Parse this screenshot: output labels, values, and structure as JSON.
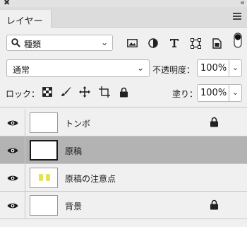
{
  "panel": {
    "close_glyph": "✖",
    "collapse_glyph": "‹‹",
    "tab_label": "レイヤー",
    "menu_icon": "hamburger-icon"
  },
  "filter": {
    "kind_label": "種類",
    "icons": [
      "image-filter-icon",
      "adjustment-filter-icon",
      "text-filter-icon",
      "shape-filter-icon",
      "smart-object-filter-icon",
      "filter-toggle-icon"
    ]
  },
  "blend": {
    "mode": "通常",
    "opacity_label": "不透明度：",
    "opacity_value": "100%"
  },
  "lock": {
    "label": "ロック：",
    "icons": [
      "lock-transparent-pixels-icon",
      "lock-image-pixels-icon",
      "lock-position-icon",
      "lock-artboard-icon",
      "lock-all-icon"
    ],
    "fill_label": "塗り：",
    "fill_value": "100%"
  },
  "layers": [
    {
      "name": "トンボ",
      "thumbnail": "transparent",
      "visible": true,
      "locked": true,
      "selected": false
    },
    {
      "name": "原稿",
      "thumbnail": "transparent",
      "visible": true,
      "locked": false,
      "selected": true
    },
    {
      "name": "原稿の注意点",
      "thumbnail": "yellow-marks",
      "visible": true,
      "locked": false,
      "selected": false
    },
    {
      "name": "背景",
      "thumbnail": "white",
      "visible": true,
      "locked": true,
      "selected": false
    }
  ]
}
